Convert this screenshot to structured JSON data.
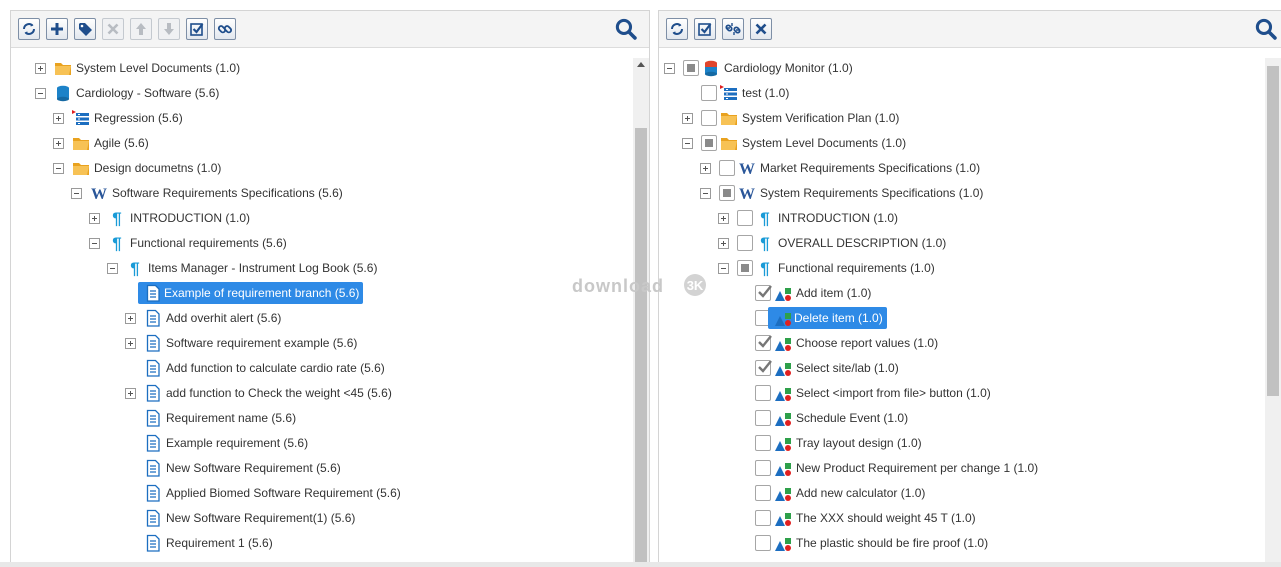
{
  "left": {
    "toolbar": [
      {
        "name": "refresh-button",
        "icon": "refresh-icon",
        "disabled": false
      },
      {
        "name": "add-button",
        "icon": "plus-icon",
        "disabled": false
      },
      {
        "name": "tag-button",
        "icon": "tag-icon",
        "disabled": false
      },
      {
        "name": "delete-button",
        "icon": "close-icon",
        "disabled": true
      },
      {
        "name": "move-up-button",
        "icon": "arrow-up-icon",
        "disabled": true
      },
      {
        "name": "move-down-button",
        "icon": "arrow-down-icon",
        "disabled": true
      },
      {
        "name": "check-button",
        "icon": "checkbox-icon",
        "disabled": false
      },
      {
        "name": "link-button",
        "icon": "link-icon",
        "disabled": false
      }
    ],
    "tree": [
      {
        "label": "System Level Documents (1.0)",
        "icon": "folder-icon",
        "level": 0,
        "exp": "plus"
      },
      {
        "label": "Cardiology - Software (5.6)",
        "icon": "database-icon",
        "level": 0,
        "exp": "minus"
      },
      {
        "label": "Regression (5.6)",
        "icon": "test-list-icon",
        "level": 1,
        "exp": "plus"
      },
      {
        "label": "Agile (5.6)",
        "icon": "folder-icon",
        "level": 1,
        "exp": "plus"
      },
      {
        "label": "Design documetns (1.0)",
        "icon": "folder-icon",
        "level": 1,
        "exp": "minus"
      },
      {
        "label": "Software Requirements Specifications (5.6)",
        "icon": "word-icon",
        "level": 2,
        "exp": "minus"
      },
      {
        "label": "INTRODUCTION (1.0)",
        "icon": "paragraph-icon",
        "level": 3,
        "exp": "plus"
      },
      {
        "label": "Functional requirements (5.6)",
        "icon": "paragraph-icon",
        "level": 3,
        "exp": "minus"
      },
      {
        "label": "Items Manager - Instrument Log Book (5.6)",
        "icon": "paragraph-icon",
        "level": 4,
        "exp": "minus"
      },
      {
        "label": "Example of requirement branch (5.6)",
        "icon": "document-icon",
        "level": 5,
        "exp": "none",
        "selected": true
      },
      {
        "label": "Add overhit alert (5.6)",
        "icon": "document-icon",
        "level": 5,
        "exp": "plus"
      },
      {
        "label": "Software requirement example (5.6)",
        "icon": "document-icon",
        "level": 5,
        "exp": "plus"
      },
      {
        "label": "Add function to calculate cardio rate (5.6)",
        "icon": "document-icon",
        "level": 5,
        "exp": "none"
      },
      {
        "label": "add function to Check the weight <45 (5.6)",
        "icon": "document-icon",
        "level": 5,
        "exp": "plus"
      },
      {
        "label": "Requirement name (5.6)",
        "icon": "document-icon",
        "level": 5,
        "exp": "none"
      },
      {
        "label": "Example requirement (5.6)",
        "icon": "document-icon",
        "level": 5,
        "exp": "none"
      },
      {
        "label": "New Software Requirement (5.6)",
        "icon": "document-icon",
        "level": 5,
        "exp": "none"
      },
      {
        "label": "Applied Biomed Software Requirement (5.6)",
        "icon": "document-icon",
        "level": 5,
        "exp": "none"
      },
      {
        "label": "New Software Requirement(1) (5.6)",
        "icon": "document-icon",
        "level": 5,
        "exp": "none"
      },
      {
        "label": "Requirement 1 (5.6)",
        "icon": "document-icon",
        "level": 5,
        "exp": "none"
      }
    ]
  },
  "right": {
    "toolbar": [
      {
        "name": "refresh-button",
        "icon": "refresh-icon",
        "disabled": false
      },
      {
        "name": "check-all-button",
        "icon": "checkbox-icon",
        "disabled": false
      },
      {
        "name": "unlink-button",
        "icon": "unlink-icon",
        "disabled": false
      },
      {
        "name": "close-button",
        "icon": "close-icon",
        "disabled": false
      }
    ],
    "tree": [
      {
        "label": "Cardiology Monitor (1.0)",
        "icon": "database-red-icon",
        "level": 0,
        "exp": "minus",
        "check": "partial"
      },
      {
        "label": "test (1.0)",
        "icon": "test-list-icon",
        "level": 1,
        "exp": "none",
        "check": "none"
      },
      {
        "label": "System Verification Plan (1.0)",
        "icon": "folder-icon",
        "level": 1,
        "exp": "plus",
        "check": "none"
      },
      {
        "label": "System Level Documents (1.0)",
        "icon": "folder-icon",
        "level": 1,
        "exp": "minus",
        "check": "partial"
      },
      {
        "label": "Market Requirements Specifications (1.0)",
        "icon": "word-icon",
        "level": 2,
        "exp": "plus",
        "check": "none"
      },
      {
        "label": "System Requirements Specifications (1.0)",
        "icon": "word-icon",
        "level": 2,
        "exp": "minus",
        "check": "partial"
      },
      {
        "label": "INTRODUCTION (1.0)",
        "icon": "paragraph-icon",
        "level": 3,
        "exp": "plus",
        "check": "none"
      },
      {
        "label": "OVERALL DESCRIPTION (1.0)",
        "icon": "paragraph-icon",
        "level": 3,
        "exp": "plus",
        "check": "none"
      },
      {
        "label": "Functional requirements (1.0)",
        "icon": "paragraph-icon",
        "level": 3,
        "exp": "minus",
        "check": "partial"
      },
      {
        "label": "Add item (1.0)",
        "icon": "shapes-icon",
        "level": 4,
        "exp": "none",
        "check": "checked"
      },
      {
        "label": "Delete item (1.0)",
        "icon": "shapes-icon",
        "level": 4,
        "exp": "none",
        "check": "none",
        "selected": true
      },
      {
        "label": "Choose report values (1.0)",
        "icon": "shapes-icon",
        "level": 4,
        "exp": "none",
        "check": "checked"
      },
      {
        "label": "Select site/lab (1.0)",
        "icon": "shapes-icon",
        "level": 4,
        "exp": "none",
        "check": "checked"
      },
      {
        "label": "Select <import from file> button (1.0)",
        "icon": "shapes-icon",
        "level": 4,
        "exp": "none",
        "check": "none"
      },
      {
        "label": "Schedule Event (1.0)",
        "icon": "shapes-icon",
        "level": 4,
        "exp": "none",
        "check": "none"
      },
      {
        "label": "Tray layout design (1.0)",
        "icon": "shapes-icon",
        "level": 4,
        "exp": "none",
        "check": "none"
      },
      {
        "label": "New Product Requirement per change 1 (1.0)",
        "icon": "shapes-icon",
        "level": 4,
        "exp": "none",
        "check": "none"
      },
      {
        "label": "Add new calculator (1.0)",
        "icon": "shapes-icon",
        "level": 4,
        "exp": "none",
        "check": "none"
      },
      {
        "label": "The XXX should weight 45 T (1.0)",
        "icon": "shapes-icon",
        "level": 4,
        "exp": "none",
        "check": "none"
      },
      {
        "label": "The plastic should be fire proof (1.0)",
        "icon": "shapes-icon",
        "level": 4,
        "exp": "none",
        "check": "none"
      }
    ]
  },
  "watermark": {
    "text": "download",
    "badge": "3K"
  },
  "colors": {
    "selection": "#2e8ae6",
    "toolbar_icon": "#1f4e8c",
    "folder": "#f5b342",
    "paragraph": "#1a9bd7"
  }
}
